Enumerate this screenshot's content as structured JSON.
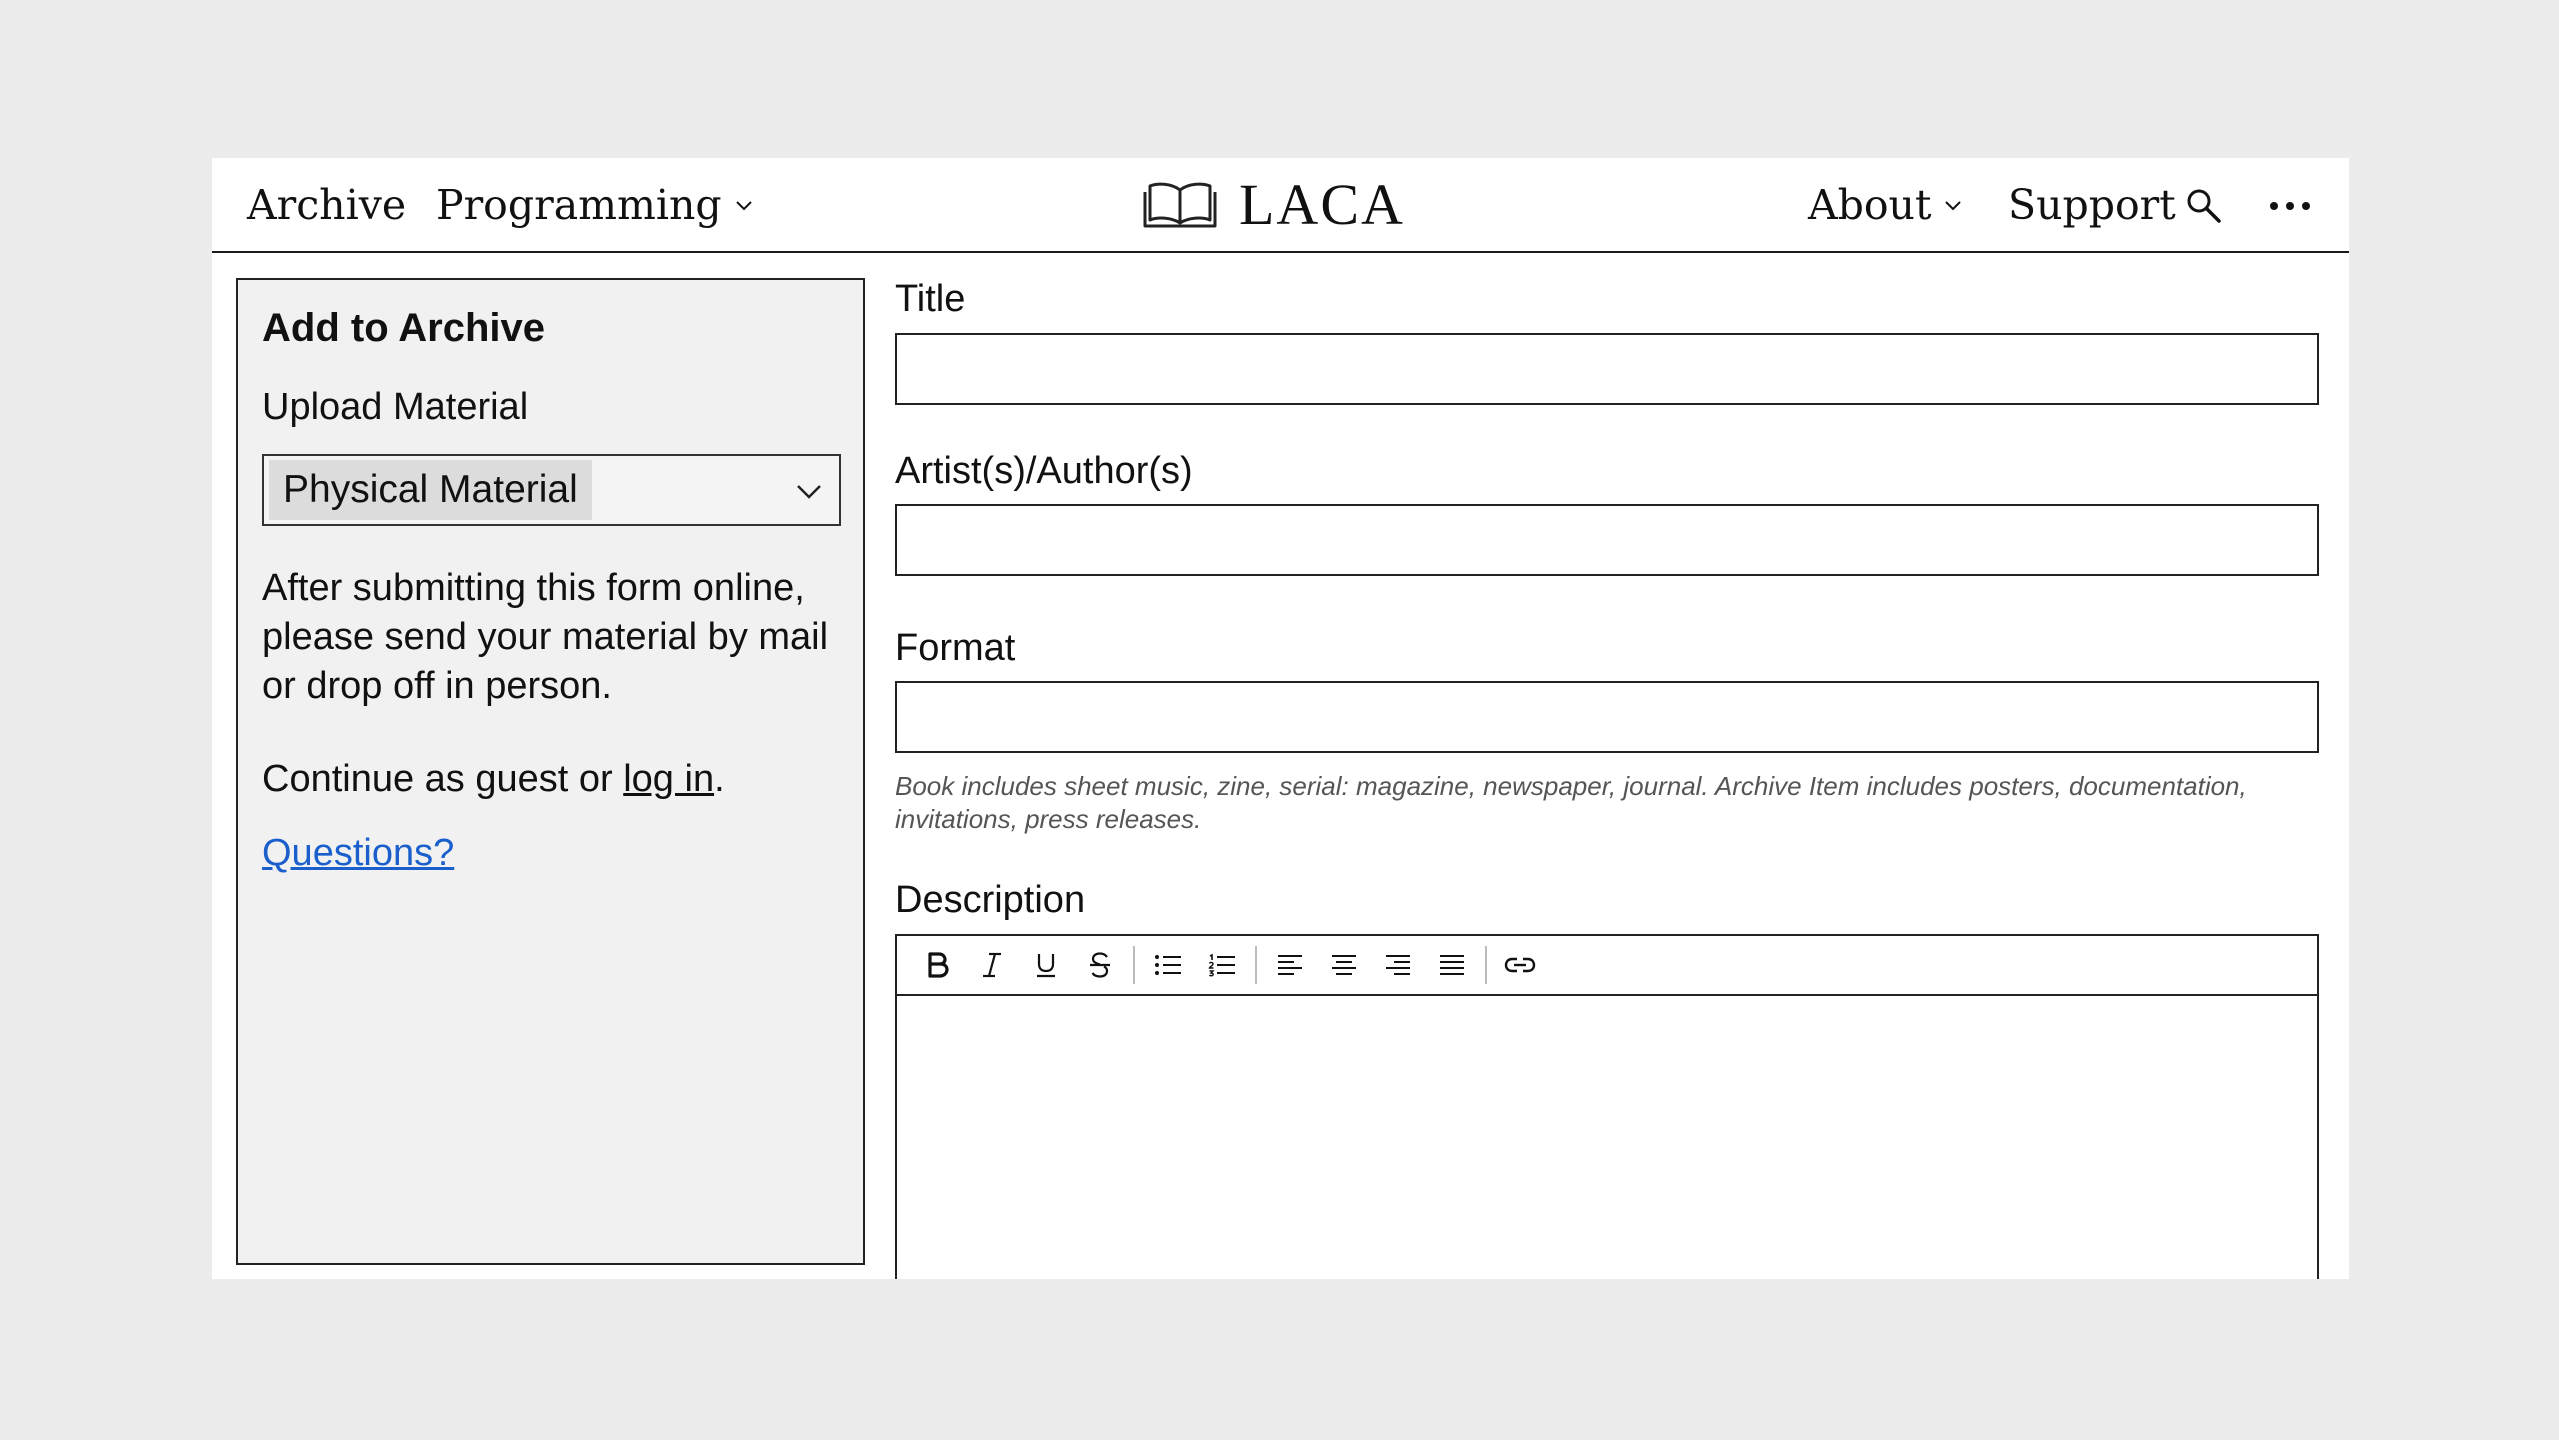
{
  "header": {
    "nav_left": [
      {
        "label": "Archive"
      },
      {
        "label": "Programming",
        "has_dropdown": true
      }
    ],
    "logo": {
      "text": "LACA",
      "icon": "open-book-icon"
    },
    "nav_right": [
      {
        "label": "About",
        "has_dropdown": true
      },
      {
        "label": "Support"
      }
    ],
    "icons": [
      "search-icon",
      "more-icon"
    ]
  },
  "sidebar": {
    "title": "Add to Archive",
    "upload_label": "Upload Material",
    "select_value": "Physical Material",
    "instructions": "After submitting this form online, please send your material by mail or drop off in person.",
    "continue_prefix": "Continue as guest or ",
    "login_link": "log in",
    "continue_suffix": ".",
    "questions_link": "Questions?"
  },
  "form": {
    "title_label": "Title",
    "title_value": "",
    "artist_label": "Artist(s)/Author(s)",
    "artist_value": "",
    "format_label": "Format",
    "format_value": "",
    "format_help": "Book includes sheet music, zine, serial: magazine, newspaper, journal. Archive Item includes posters, documentation, invitations, press releases.",
    "description_label": "Description",
    "toolbar": [
      "bold-icon",
      "italic-icon",
      "underline-icon",
      "strikethrough-icon",
      "bullet-list-icon",
      "numbered-list-icon",
      "align-left-icon",
      "align-center-icon",
      "align-right-icon",
      "justify-icon",
      "link-icon"
    ]
  },
  "colors": {
    "page_background": "#ececec",
    "sidebar_background": "#f1f1f1",
    "link_blue": "#1a5fcc",
    "help_text": "#555555"
  }
}
